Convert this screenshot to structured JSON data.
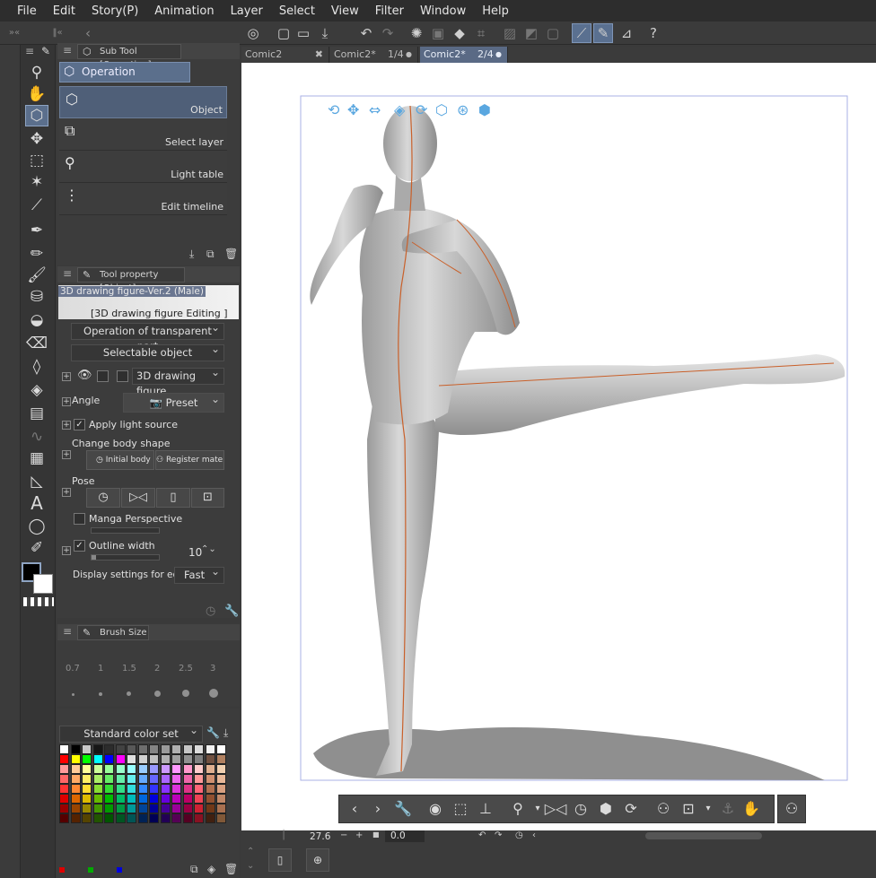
{
  "menu": [
    "File",
    "Edit",
    "Story(P)",
    "Animation",
    "Layer",
    "Select",
    "View",
    "Filter",
    "Window",
    "Help"
  ],
  "subtool_panel": {
    "tab_label": "Sub Tool [Operation]",
    "group": "Operation",
    "items": [
      "Object",
      "Select layer",
      "Light table",
      "Edit timeline"
    ]
  },
  "tool_property": {
    "tab_label": "Tool property [Object]",
    "model_name": "3D drawing figure-Ver.2 (Male)",
    "editing_label": "[3D drawing figure Editing ]",
    "transparent_part": "Operation of transparent part",
    "selectable_object": "Selectable object",
    "figure_select": "3D drawing figure",
    "angle_label": "Angle",
    "preset_label": "Preset",
    "apply_light": "Apply light source",
    "change_body_shape": "Change body shape",
    "initial_body_shape": "Initial body sha",
    "register_material": "Register mater",
    "pose_label": "Pose",
    "manga_perspective": "Manga Perspective",
    "outline_width": "Outline width",
    "outline_value": "10",
    "display_settings": "Display settings for editing",
    "display_value": "Fast"
  },
  "brush_size": {
    "tab_label": "Brush Size",
    "sizes": [
      "0.7",
      "1",
      "1.5",
      "2",
      "2.5",
      "3"
    ]
  },
  "color_set": {
    "name": "Standard color set"
  },
  "documents": [
    {
      "name": "Comic2",
      "page": ""
    },
    {
      "name": "Comic2*",
      "page": "1/4"
    },
    {
      "name": "Comic2*",
      "page": "2/4"
    }
  ],
  "status": {
    "zoom": "27.6",
    "rotation": "0.0"
  },
  "icons": {
    "pose_reset": "reset-icon",
    "flip": "flip-icon",
    "clipboard": "clipboard-icon",
    "figure": "figure-icon"
  },
  "colors": {
    "menubar": "#2d2d2d",
    "panel": "#3c3c3c",
    "selected": "#5b6f8c",
    "canvas": "#ffffff",
    "guide": "#aab0e6",
    "orange_line": "#c9602a"
  }
}
